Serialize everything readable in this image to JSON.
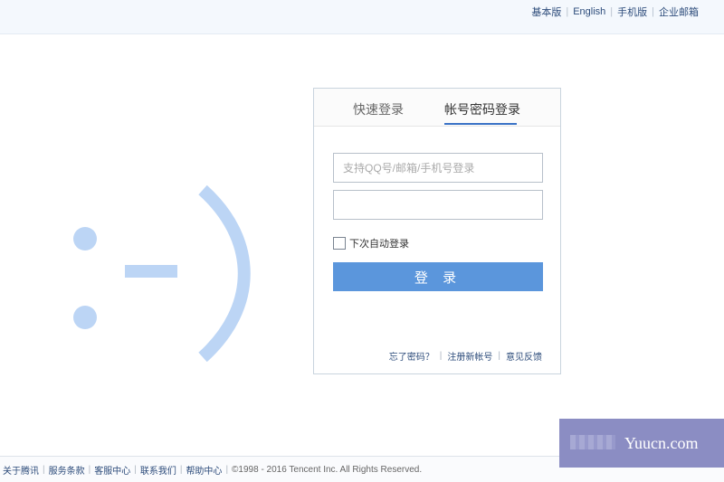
{
  "top_links": {
    "basic": "基本版",
    "english": "English",
    "mobile": "手机版",
    "enterprise": "企业邮箱"
  },
  "decoration": {
    "smiley_color": "#bcd5f5"
  },
  "login": {
    "tabs": {
      "quick": "快速登录",
      "account": "帐号密码登录"
    },
    "active_tab": "帐号密码登录",
    "username": {
      "placeholder": "支持QQ号/邮箱/手机号登录",
      "value": ""
    },
    "password": {
      "placeholder": "",
      "value": ""
    },
    "remember_label": "下次自动登录",
    "remember_checked": false,
    "submit_label": "登 录",
    "links": {
      "forgot": "忘了密码？",
      "register": "注册新帐号",
      "feedback": "意见反馈"
    }
  },
  "footer": {
    "links": [
      "关于腾讯",
      "服务条款",
      "客服中心",
      "联系我们",
      "帮助中心"
    ],
    "copyright": "©1998 - 2016 Tencent Inc. All Rights Reserved."
  },
  "watermark": {
    "text": "Yuucn.com"
  },
  "colors": {
    "accent": "#5b96dc",
    "link": "#2d4c7b",
    "watermark_bg": "#8b8dc3"
  }
}
